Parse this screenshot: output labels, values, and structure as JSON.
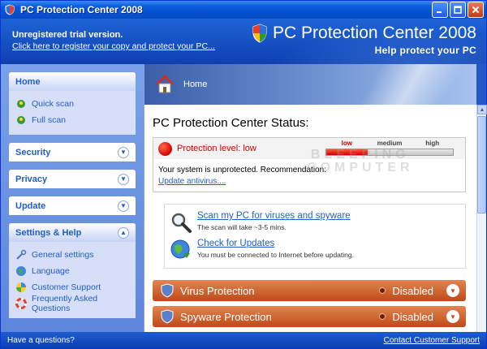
{
  "window": {
    "title": "PC Protection Center 2008"
  },
  "header": {
    "trial_notice": "Unregistered trial version.",
    "register_link": "Click here to register your copy and protect your PC...",
    "brand_title": "PC Protection Center 2008",
    "brand_subtitle": "Help protect your PC"
  },
  "sidebar": {
    "home": {
      "title": "Home",
      "items": [
        {
          "label": "Quick scan"
        },
        {
          "label": "Full scan"
        }
      ]
    },
    "security": {
      "title": "Security"
    },
    "privacy": {
      "title": "Privacy"
    },
    "update": {
      "title": "Update"
    },
    "settings": {
      "title": "Settings & Help",
      "items": [
        {
          "label": "General settings"
        },
        {
          "label": "Language"
        },
        {
          "label": "Customer Support"
        },
        {
          "label": "Frequently Asked Questions"
        }
      ]
    }
  },
  "content": {
    "breadcrumb": "Home",
    "status_title": "PC Protection Center Status:",
    "protection_level": "Protection level: low",
    "meter": {
      "labels": [
        "low",
        "medium",
        "high"
      ],
      "level": 0.33
    },
    "recommendation": "Your system is unprotected. Recommendation:",
    "update_link": "Update antivirus....",
    "watermark": "BLEEPING\nCOMPUTER",
    "actions": [
      {
        "link": "Scan my PC for viruses and spyware",
        "note": "The scan will take ~3-5 mins."
      },
      {
        "link": "Check for Updates",
        "note": "You must be connected to Internet before updating."
      }
    ],
    "protections": [
      {
        "name": "Virus Protection",
        "state": "Disabled"
      },
      {
        "name": "Spyware Protection",
        "state": "Disabled"
      }
    ]
  },
  "footer": {
    "left_text": "Have a questions?",
    "support_link": "Contact Customer Support"
  },
  "colors": {
    "accent": "#215dc6",
    "alert": "#d40000",
    "protbar": "#bd4a16"
  }
}
